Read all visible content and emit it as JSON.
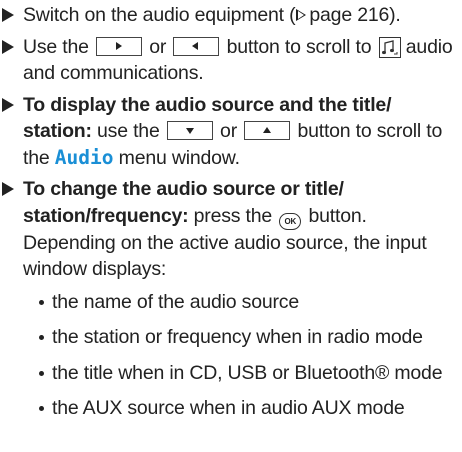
{
  "steps": [
    {
      "pre": "Switch on the audio equipment (",
      "page_ref": "page 216",
      "post": ")."
    },
    {
      "t1": "Use the",
      "t2": "or",
      "t3": "button to scroll to",
      "t4": "audio and communications."
    },
    {
      "bold": "To display the audio source and the title/ station:",
      "t1": "use the",
      "t2": "or",
      "t3": "button to scroll to the",
      "menu": "Audio",
      "t4": "menu window."
    },
    {
      "bold": "To change the audio source or title/ station/frequency:",
      "t1": "press the",
      "ok_label": "OK",
      "t2": "button. Depending on the active audio source, the input window displays:",
      "bullets": [
        "the name of the audio source",
        "the station or frequency when in radio mode",
        "the title when in CD, USB or Bluetooth® mode",
        "the AUX source when in audio AUX mode"
      ]
    }
  ],
  "colors": {
    "text": "#222222",
    "menu_accent": "#1a8fd6"
  },
  "icons": [
    "right-triangle-bullet",
    "right-arrow-button",
    "left-arrow-button",
    "down-arrow-button",
    "up-arrow-button",
    "audio-icon",
    "ok-button-icon",
    "page-reference-triangle"
  ]
}
